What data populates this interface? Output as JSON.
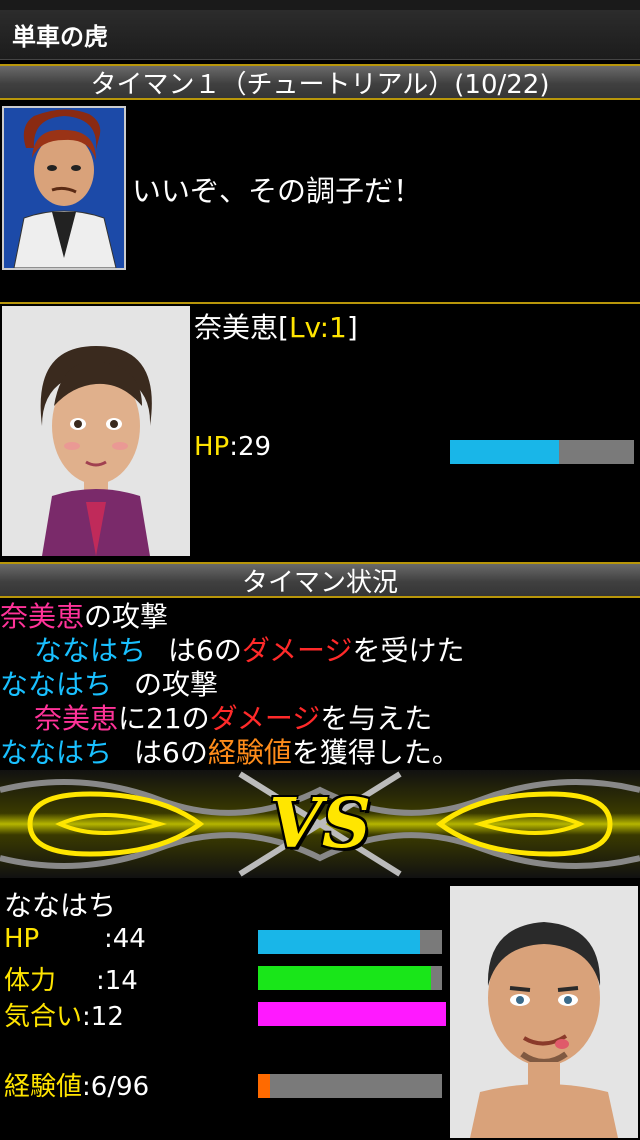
{
  "app": {
    "title": "単車の虎"
  },
  "battle_header": "タイマン１（チュートリアル）(10/22)",
  "boss": {
    "message": "いいぞ、その調子だ！"
  },
  "enemy": {
    "name": "奈美恵",
    "level_open": "[",
    "level": "Lv:1",
    "level_close": "]",
    "hp_label": "HP",
    "hp_value": ":29",
    "hp_fraction": 0.59
  },
  "status_header": "タイマン状況",
  "log": {
    "l1": {
      "a": "奈美恵",
      "b": "の攻撃"
    },
    "l2": {
      "a": "ななはち",
      "b": "は6の",
      "c": "ダメージ",
      "d": "を受けた"
    },
    "l3": {
      "a": "ななはち",
      "b": "の攻撃"
    },
    "l4": {
      "a": "奈美恵",
      "b": "に21の",
      "c": "ダメージ",
      "d": "を与えた"
    },
    "l5": {
      "a": "ななはち",
      "b": "は6の",
      "c": "経験値",
      "d": "を獲得した。"
    }
  },
  "vs_text": "VS",
  "player": {
    "name": "ななはち",
    "hp_label": "HP",
    "hp_value": ":44",
    "hp_fraction": 0.88,
    "stamina_label": "体力",
    "stamina_value": ":14",
    "stamina_fraction": 0.94,
    "spirit_label": "気合い",
    "spirit_value": ":12",
    "spirit_fraction": 1.0,
    "exp_label": "経験値",
    "exp_value": ":6/96",
    "exp_fraction": 0.0625
  },
  "colors": {
    "gold": "#b8960a",
    "hp_bar": "#19b6e8",
    "stamina_bar": "#19e619",
    "spirit_bar": "#ff19ff",
    "exp_bar": "#ff6a00",
    "bar_bg": "#7a7a7a"
  },
  "icons": {
    "boss": "boss-portrait",
    "enemy": "enemy-portrait",
    "player": "player-portrait"
  }
}
